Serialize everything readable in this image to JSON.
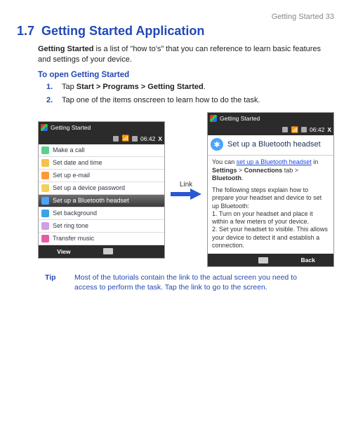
{
  "header": {
    "text": "Getting Started  33"
  },
  "section": {
    "number": "1.7",
    "title": "Getting Started Application"
  },
  "intro": {
    "lead": "Getting Started",
    "rest": " is a list of \"how to's\" that you can reference to learn basic features and settings of your device."
  },
  "subhead": "To open Getting Started",
  "steps": [
    {
      "num": "1.",
      "pre": "Tap ",
      "bold": "Start > Programs > Getting Started",
      "post": "."
    },
    {
      "num": "2.",
      "pre": "Tap one of the items onscreen to learn how to do the task.",
      "bold": "",
      "post": ""
    }
  ],
  "phone_left": {
    "title": "Getting Started",
    "time": "06:42",
    "softkeys": {
      "left": "View",
      "right": ""
    },
    "items": [
      {
        "icon": "ico-phone",
        "label": "Make a call"
      },
      {
        "icon": "ico-clock",
        "label": "Set date and time"
      },
      {
        "icon": "ico-mail",
        "label": "Set up e-mail"
      },
      {
        "icon": "ico-lock",
        "label": "Set up a device password"
      },
      {
        "icon": "ico-bt",
        "label": "Set up a Bluetooth headset",
        "selected": true
      },
      {
        "icon": "ico-bg",
        "label": "Set background"
      },
      {
        "icon": "ico-ring",
        "label": "Set ring tone"
      },
      {
        "icon": "ico-music",
        "label": "Transfer music"
      }
    ]
  },
  "link_label": "Link",
  "phone_right": {
    "title": "Getting Started",
    "time": "06:42",
    "softkeys": {
      "left": "",
      "right": "Back"
    },
    "detail_title": "Set up a Bluetooth headset",
    "p1_pre": "You can ",
    "p1_link": "set up a Bluetooth headset",
    "p1_mid": " in ",
    "p1_b1": "Settings",
    "p1_sep": " > ",
    "p1_b2": "Connections",
    "p1_mid2": " tab > ",
    "p1_b3": "Bluetooth",
    "p1_post": ".",
    "p2": "The following steps explain how to prepare your headset and device to set up Bluetooth:",
    "p3": "1. Turn on your headset and place it within a few meters of your device.",
    "p4": "2. Set your headset to visible. This allows your device to detect it and establish a connection."
  },
  "tip": {
    "label": "Tip",
    "text": "Most of the tutorials contain the link to the actual screen you need to access to perform the task. Tap the link to go to the screen."
  }
}
